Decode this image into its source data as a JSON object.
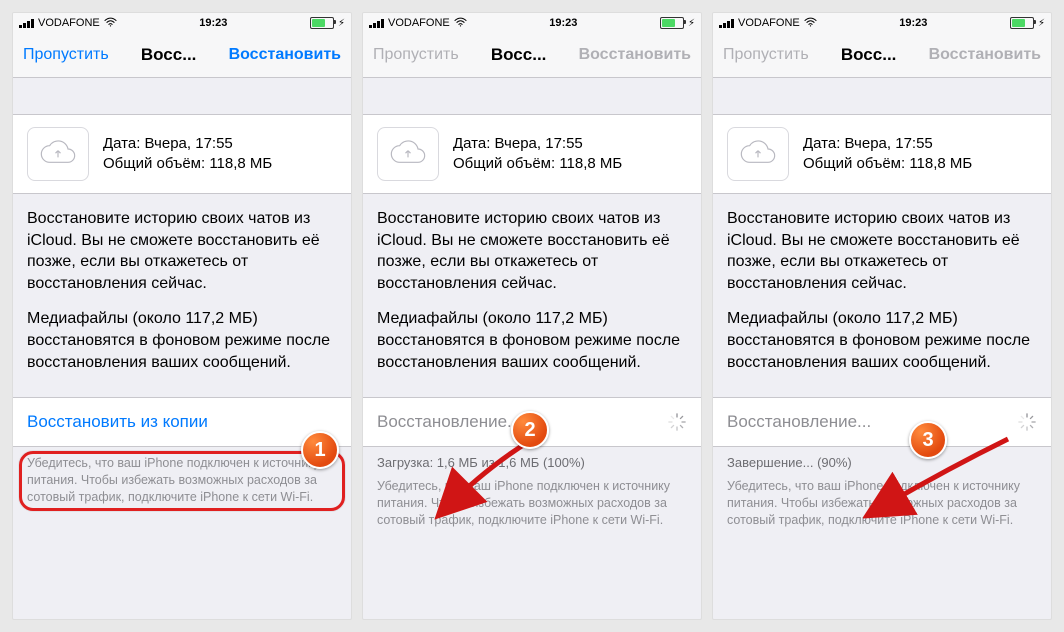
{
  "status": {
    "carrier": "VODAFONE",
    "time": "19:23"
  },
  "nav": {
    "left": "Пропустить",
    "title": "Восс...",
    "right": "Восстановить"
  },
  "backup": {
    "date_label": "Дата: Вчера, 17:55",
    "size_label": "Общий объём: 118,8 МБ"
  },
  "body": {
    "p1": "Восстановите историю своих чатов из iCloud. Вы не сможете восстановить её позже, если вы откажетесь от восстановления сейчас.",
    "p2": "Медиафайлы (около 117,2 МБ) восстановятся в фоновом режиме после восстановления ваших сообщений."
  },
  "footer": "Убедитесь, что ваш iPhone подключен к источнику питания. Чтобы избежать возможных расходов за сотовый трафик, подключите iPhone к сети Wi-Fi.",
  "screens": {
    "s1": {
      "action_label": "Восстановить из копии"
    },
    "s2": {
      "action_label": "Восстановление...",
      "progress": "Загрузка: 1,6 МБ из 1,6 МБ (100%)"
    },
    "s3": {
      "action_label": "Восстановление...",
      "progress": "Завершение... (90%)"
    }
  },
  "badges": {
    "b1": "1",
    "b2": "2",
    "b3": "3"
  }
}
